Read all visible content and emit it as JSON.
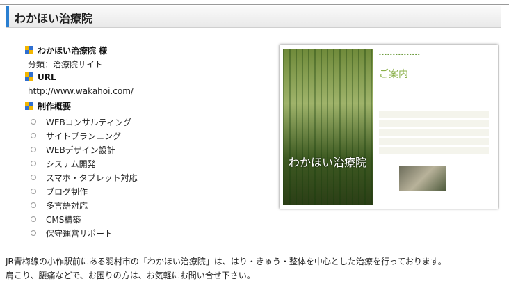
{
  "header": {
    "title": "わかほい治療院"
  },
  "info": {
    "client_label": "わかほい治療院 様",
    "category": "分類：治療院サイト",
    "url_label": "URL",
    "url": "http://www.wakahoi.com/",
    "services_label": "制作概要",
    "services": [
      "WEBコンサルティング",
      "サイトプランニング",
      "WEBデザイン設計",
      "システム開発",
      "スマホ・タブレット対応",
      "ブログ制作",
      "多言語対応",
      "CMS構築",
      "保守運営サポート"
    ]
  },
  "screenshot": {
    "site_title": "わかほい治療院",
    "heading": "ご案内"
  },
  "description": {
    "line1": "JR青梅線の小作駅前にある羽村市の「わかほい治療院」は、はり・きゅう・整体を中心とした治療を行っております。",
    "line2": "肩こり、腰痛などで、お困りの方は、お気軽にお問い合せ下さい。"
  }
}
